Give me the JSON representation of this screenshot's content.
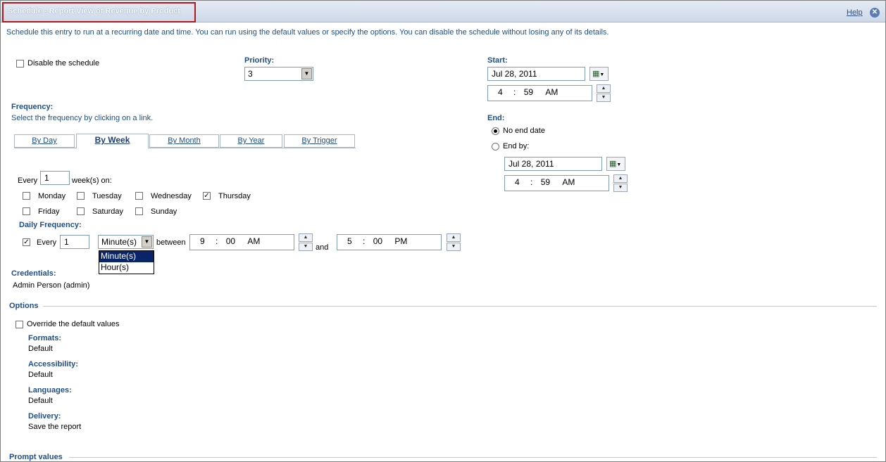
{
  "header": {
    "title": "Schedule - Report View of Revenue by Product",
    "help_label": "Help",
    "close_icon": "close-icon"
  },
  "intro_text": "Schedule this entry to run at a recurring date and time. You can run using the default values or specify the options. You can disable the schedule without losing any of its details.",
  "disable_label": "Disable the schedule",
  "priority": {
    "label": "Priority:",
    "value": "3"
  },
  "start": {
    "label": "Start:",
    "date": "Jul 28, 2011",
    "hour": "4",
    "minute": "59",
    "ampm": "AM"
  },
  "end": {
    "label": "End:",
    "no_end_label": "No end date",
    "end_by_label": "End by:",
    "date": "Jul 28, 2011",
    "hour": "4",
    "minute": "59",
    "ampm": "AM"
  },
  "frequency": {
    "label": "Frequency:",
    "hint": "Select the frequency by clicking on a link.",
    "tabs": [
      "By Day",
      "By Week",
      "By Month",
      "By Year",
      "By Trigger"
    ],
    "active_tab": "By Week",
    "every_prefix": "Every",
    "every_value": "1",
    "every_suffix": "week(s) on:",
    "days": {
      "monday": "Monday",
      "tuesday": "Tuesday",
      "wednesday": "Wednesday",
      "thursday": "Thursday",
      "friday": "Friday",
      "saturday": "Saturday",
      "sunday": "Sunday"
    },
    "checked_days": [
      "Thursday"
    ]
  },
  "daily": {
    "label": "Daily Frequency:",
    "every_label": "Every",
    "every_value": "1",
    "unit_value": "Minute(s)",
    "unit_options": [
      "Minute(s)",
      "Hour(s)"
    ],
    "between_label": "between",
    "and_label": "and",
    "from": {
      "hour": "9",
      "minute": "00",
      "ampm": "AM"
    },
    "to": {
      "hour": "5",
      "minute": "00",
      "ampm": "PM"
    }
  },
  "credentials": {
    "label": "Credentials:",
    "value": "Admin Person (admin)"
  },
  "options": {
    "title": "Options",
    "override_label": "Override the default values",
    "formats": {
      "label": "Formats:",
      "value": "Default"
    },
    "accessibility": {
      "label": "Accessibility:",
      "value": "Default"
    },
    "languages": {
      "label": "Languages:",
      "value": "Default"
    },
    "delivery": {
      "label": "Delivery:",
      "value": "Save the report"
    }
  },
  "prompt_values_title": "Prompt values",
  "colors": {
    "label_blue": "#1c4e8c",
    "title_border": "#b0181e",
    "selected_item": "#0a246a"
  }
}
